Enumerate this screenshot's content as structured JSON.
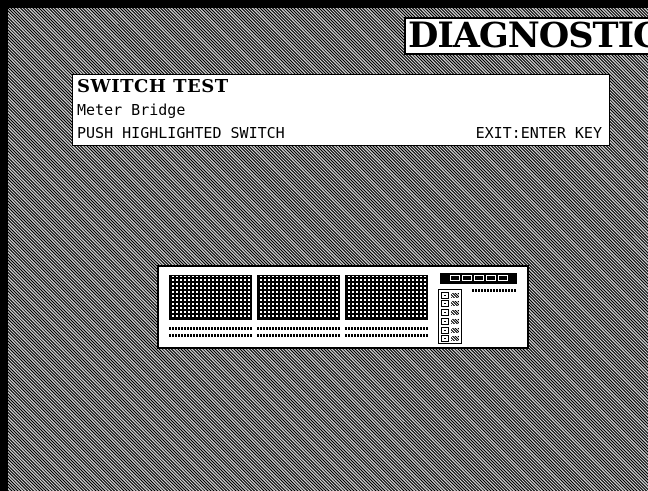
{
  "header": {
    "title": "DIAGNOSTICS"
  },
  "panel": {
    "title": "SWITCH TEST",
    "subtitle": "Meter Bridge",
    "instruction": "PUSH HIGHLIGHTED SWITCH",
    "exit_hint": "EXIT:ENTER KEY"
  },
  "bridge": {
    "meter_blocks": 3,
    "switch_rows": 6
  },
  "colors": {
    "foreground": "#000000",
    "background": "#ffffff"
  }
}
